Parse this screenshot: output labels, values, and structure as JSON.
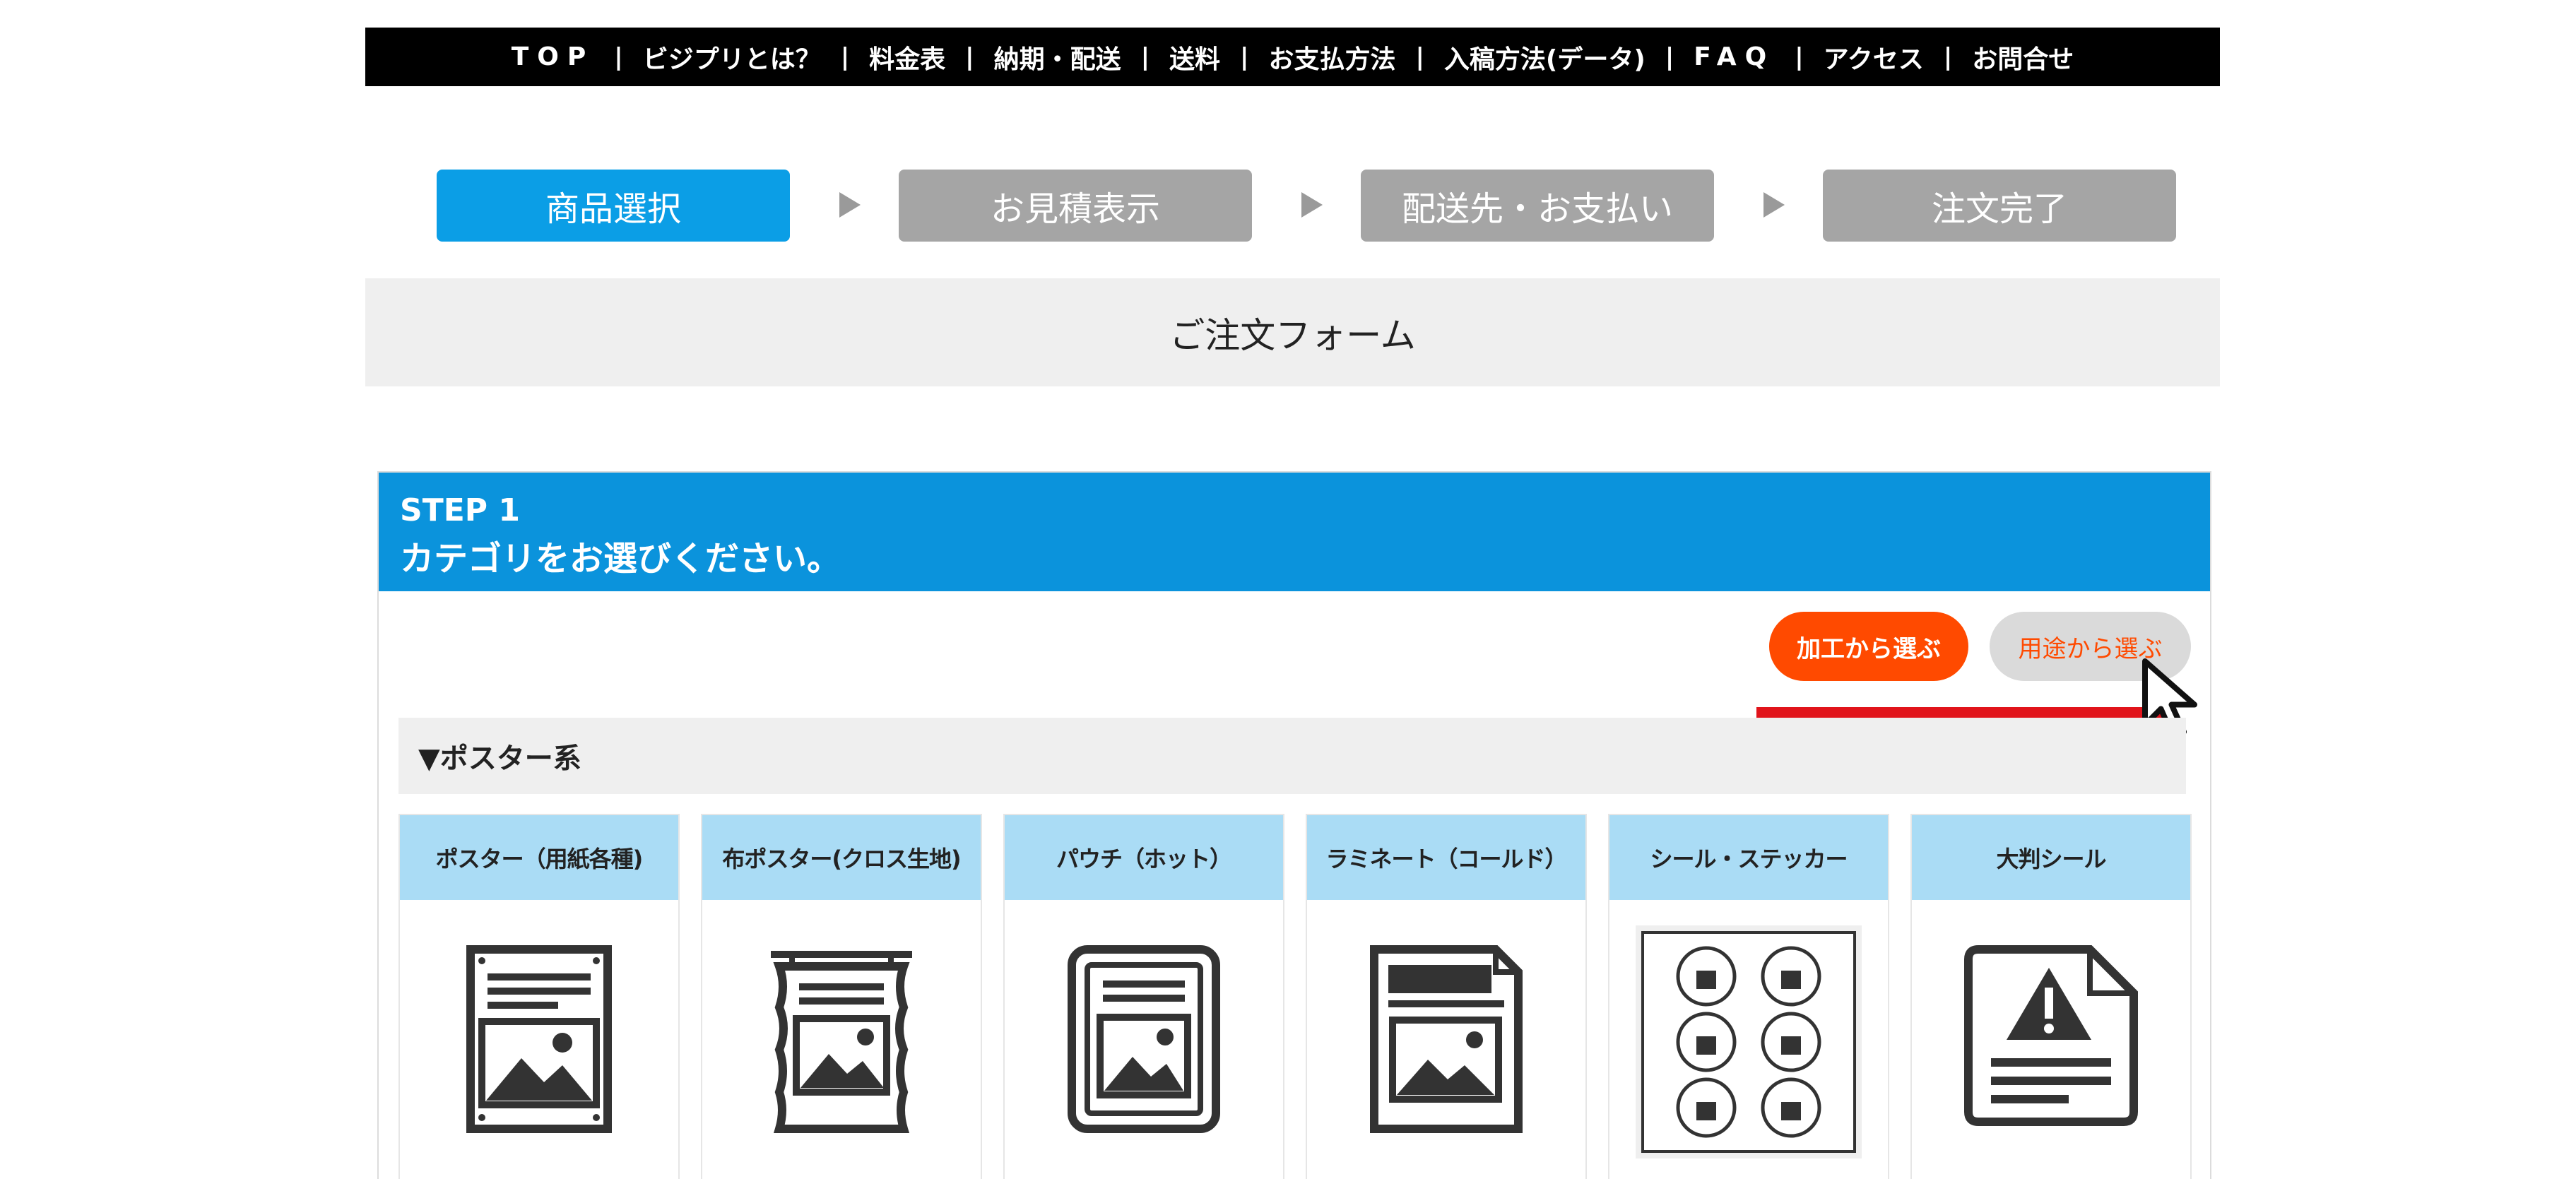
{
  "topnav": {
    "items": [
      "TOP",
      "ビジプリとは？",
      "料金表",
      "納期・配送",
      "送料",
      "お支払方法",
      "入稿方法(データ)",
      "FAQ",
      "アクセス",
      "お問合せ"
    ],
    "separator": "|"
  },
  "progress": {
    "steps": [
      "商品選択",
      "お見積表示",
      "配送先・お支払い",
      "注文完了"
    ],
    "active_index": 0
  },
  "form_title": "ご注文フォーム",
  "step_panel": {
    "step_number": "STEP 1",
    "instruction": "カテゴリをお選びください。",
    "filter_buttons": {
      "by_process": "加工から選ぶ",
      "by_purpose": "用途から選ぶ"
    },
    "category_header": "▼ポスター系",
    "products": [
      {
        "label": "ポスター（用紙各種)",
        "icon": "poster-icon"
      },
      {
        "label": "布ポスター(クロス生地)",
        "icon": "cloth-poster-icon"
      },
      {
        "label": "パウチ（ホット）",
        "icon": "pouch-icon"
      },
      {
        "label": "ラミネート（コールド）",
        "icon": "laminate-icon"
      },
      {
        "label": "シール・ステッカー",
        "icon": "sticker-sheet-icon"
      },
      {
        "label": "大判シール",
        "icon": "warning-sticker-icon"
      }
    ]
  },
  "colors": {
    "nav_bg": "#000000",
    "active_step": "#0b9ee6",
    "inactive_step": "#a5a5a5",
    "panel_header": "#0b93dc",
    "button_orange": "#ff4a00",
    "card_header": "#aadcf5",
    "highlight_bar": "#e1141b"
  }
}
